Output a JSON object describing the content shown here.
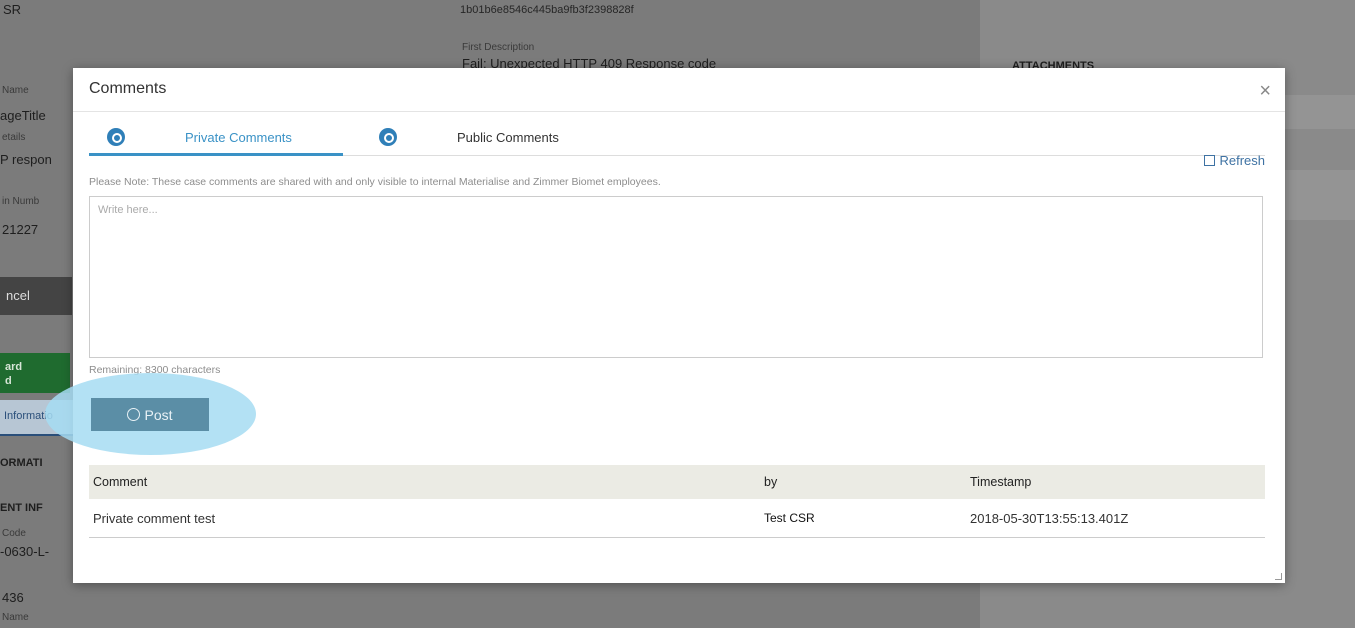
{
  "background": {
    "left_texts": [
      "SR",
      "Name",
      "ageTitle",
      "etails",
      "P respon",
      "in Numb",
      "21227",
      "ORMATI",
      "ENT INF",
      "Code",
      "-0630-L-",
      "436",
      "Name"
    ],
    "center_texts": [
      "1b01b6e8546c445ba9fb3f2398828f",
      "First Description",
      "Fail: Unexpected HTTP 409 Response code"
    ],
    "right_title": "ATTACHMENTS",
    "cancel_label": "ncel",
    "green_lines": [
      "ard",
      "d"
    ],
    "tab_label": "Informatio"
  },
  "modal": {
    "title": "Comments",
    "close_symbol": "×",
    "tabs": [
      {
        "label": "Private Comments",
        "active": true
      },
      {
        "label": "Public Comments",
        "active": false
      }
    ],
    "refresh_label": "Refresh",
    "note": "Please Note: These case comments are shared with and only visible to internal Materialise and Zimmer Biomet employees.",
    "textarea_placeholder": "Write here...",
    "remaining": "Remaining: 8300 characters",
    "post_label": "Post",
    "table": {
      "headers": [
        "Comment",
        "by",
        "Timestamp"
      ],
      "rows": [
        [
          "Private comment test",
          "Test CSR",
          "2018-05-30T13:55:13.401Z"
        ]
      ]
    }
  },
  "colors": {
    "accent": "#3a92c6",
    "post_button": "#5b8ea6",
    "highlight": "#a6dcf2",
    "overlay": "#7b7b7b"
  }
}
